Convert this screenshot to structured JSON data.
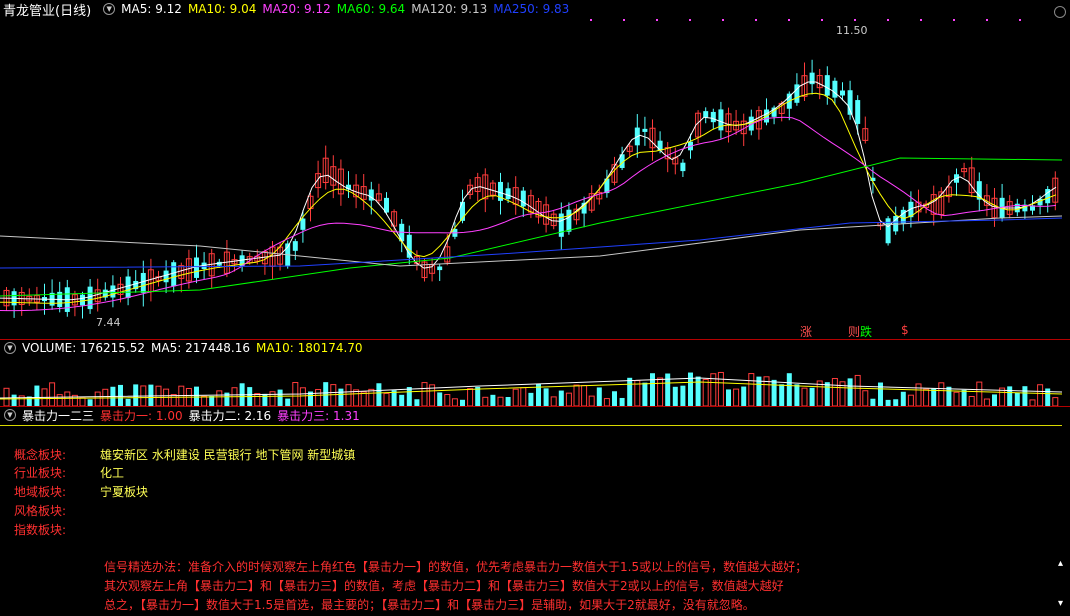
{
  "main_chart": {
    "title": "青龙管业(日线)",
    "ma_legend": [
      {
        "label": "MA5: 9.12",
        "color": "#ffffff"
      },
      {
        "label": "MA10: 9.04",
        "color": "#ffff00"
      },
      {
        "label": "MA20: 9.12",
        "color": "#ff40ff"
      },
      {
        "label": "MA60: 9.64",
        "color": "#00ff00"
      },
      {
        "label": "MA120: 9.13",
        "color": "#c8c8c8"
      },
      {
        "label": "MA250: 9.83",
        "color": "#2040ff"
      }
    ],
    "high_label": "11.50",
    "low_label": "7.44",
    "marker_zhang": "涨",
    "marker_die_prefix": "则",
    "marker_die": "跌",
    "marker_s": "$"
  },
  "volume_panel": {
    "name": "VOLUME",
    "value": "176215.52",
    "ma5": "MA5: 217448.16",
    "ma10": "MA10: 180174.70"
  },
  "indicator_panel": {
    "name": "暴击力一二三",
    "force1": "暴击力一: 1.00",
    "force2": "暴击力二: 2.16",
    "force3": "暴击力三: 1.31"
  },
  "info": {
    "concept_key": "概念板块:",
    "concept_val": "雄安新区 水利建设 民营银行 地下管网 新型城镇",
    "industry_key": "行业板块:",
    "industry_val": "化工",
    "region_key": "地域板块:",
    "region_val": "宁夏板块",
    "style_key": "风格板块:",
    "index_key": "指数板块:"
  },
  "notes": {
    "line1": "信号精选办法：准备介入的时候观察左上角红色【暴击力一】的数值，优先考虑暴击力一数值大于1.5或以上的信号，数值越大越好；",
    "line2": "其次观察左上角【暴击力二】和【暴击力三】的数值，考虑【暴击力二】和【暴击力三】数值大于2或以上的信号，数值越大越好",
    "line3": "总之，【暴击力一】数值大于1.5是首选，最主要的；【暴击力二】和【暴击力三】是辅助，如果大于2就最好，没有就忽略。"
  },
  "colors": {
    "up": "#ff3c3c",
    "down": "#54ffff",
    "frame": "#b40000",
    "label_red": "#ff3030",
    "label_yellow": "#ffff55"
  }
}
